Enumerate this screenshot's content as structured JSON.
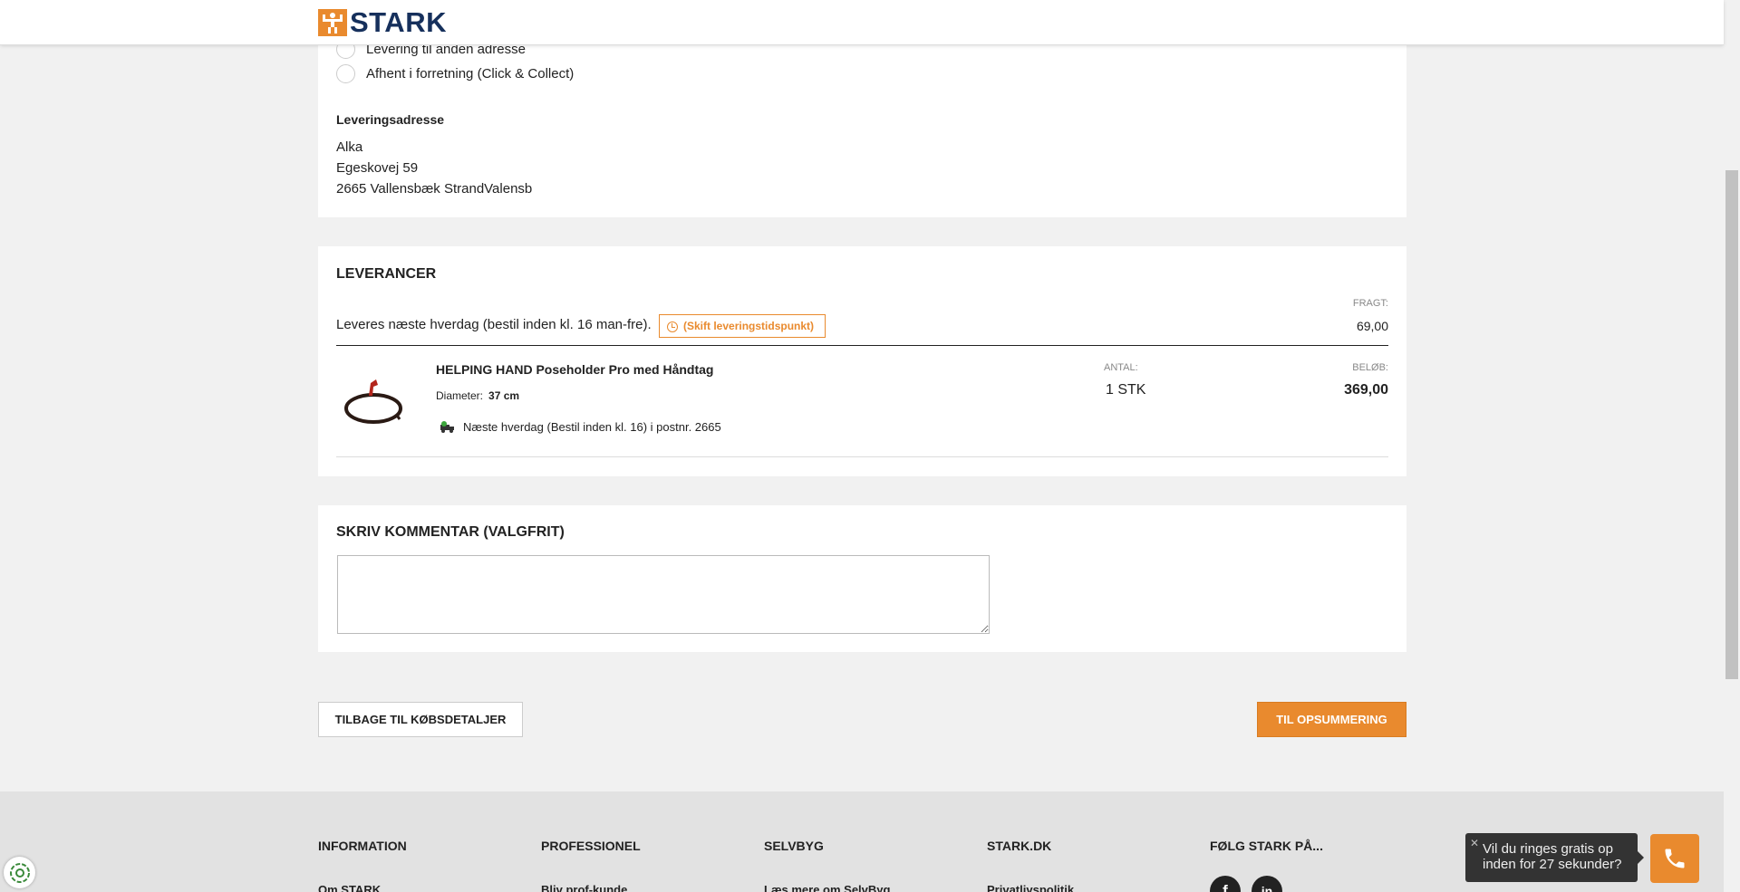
{
  "header": {
    "logo_text": "STARK"
  },
  "delivery": {
    "options": [
      {
        "label": "Levering til anden adresse"
      },
      {
        "label": "Afhent i forretning (Click & Collect)"
      }
    ],
    "address_label": "Leveringsadresse",
    "address_lines": [
      "Alka",
      "Egeskovej 59",
      "2665 Vallensbæk StrandValensb"
    ]
  },
  "leverancer": {
    "title": "LEVERANCER",
    "delivery_text": "Leveres næste hverdag (bestil inden kl. 16 man-fre).",
    "change_button": "(Skift leveringstidspunkt)",
    "freight_label": "FRAGT:",
    "freight_value": "69,00",
    "item": {
      "name": "HELPING HAND Poseholder Pro med Håndtag",
      "attr_label": "Diameter:",
      "attr_value": "37 cm",
      "shipping_text": "Næste hverdag (Bestil inden kl. 16) i postnr. 2665",
      "qty_label": "ANTAL:",
      "qty_value": "1 STK",
      "amount_label": "BELØB:",
      "amount_value": "369,00"
    }
  },
  "comment": {
    "title": "SKRIV KOMMENTAR (VALGFRIT)",
    "value": "",
    "placeholder": ""
  },
  "actions": {
    "back_label": "TILBAGE TIL KØBSDETALJER",
    "next_label": "TIL OPSUMMERING"
  },
  "footer": {
    "columns": [
      {
        "heading": "INFORMATION",
        "link": "Om STARK"
      },
      {
        "heading": "PROFESSIONEL",
        "link": "Bliv prof-kunde"
      },
      {
        "heading": "SELVBYG",
        "link": "Læs mere om SelvByg"
      },
      {
        "heading": "STARK.DK",
        "link": "Privatlivspolitik"
      },
      {
        "heading": "FØLG STARK PÅ..."
      }
    ],
    "social": [
      "f",
      "in"
    ]
  },
  "callback": {
    "close": "✕",
    "text": "Vil du ringes gratis op inden for 27 sekunder?"
  },
  "colors": {
    "accent": "#e98a2e",
    "brand_navy": "#16305c",
    "background": "#f1f1f1"
  },
  "icons": [
    "stark-logo-icon",
    "radio-icon",
    "clock-icon",
    "product-image",
    "truck-icon",
    "facebook-icon",
    "linkedin-icon",
    "phone-icon",
    "cookie-settings-icon"
  ]
}
